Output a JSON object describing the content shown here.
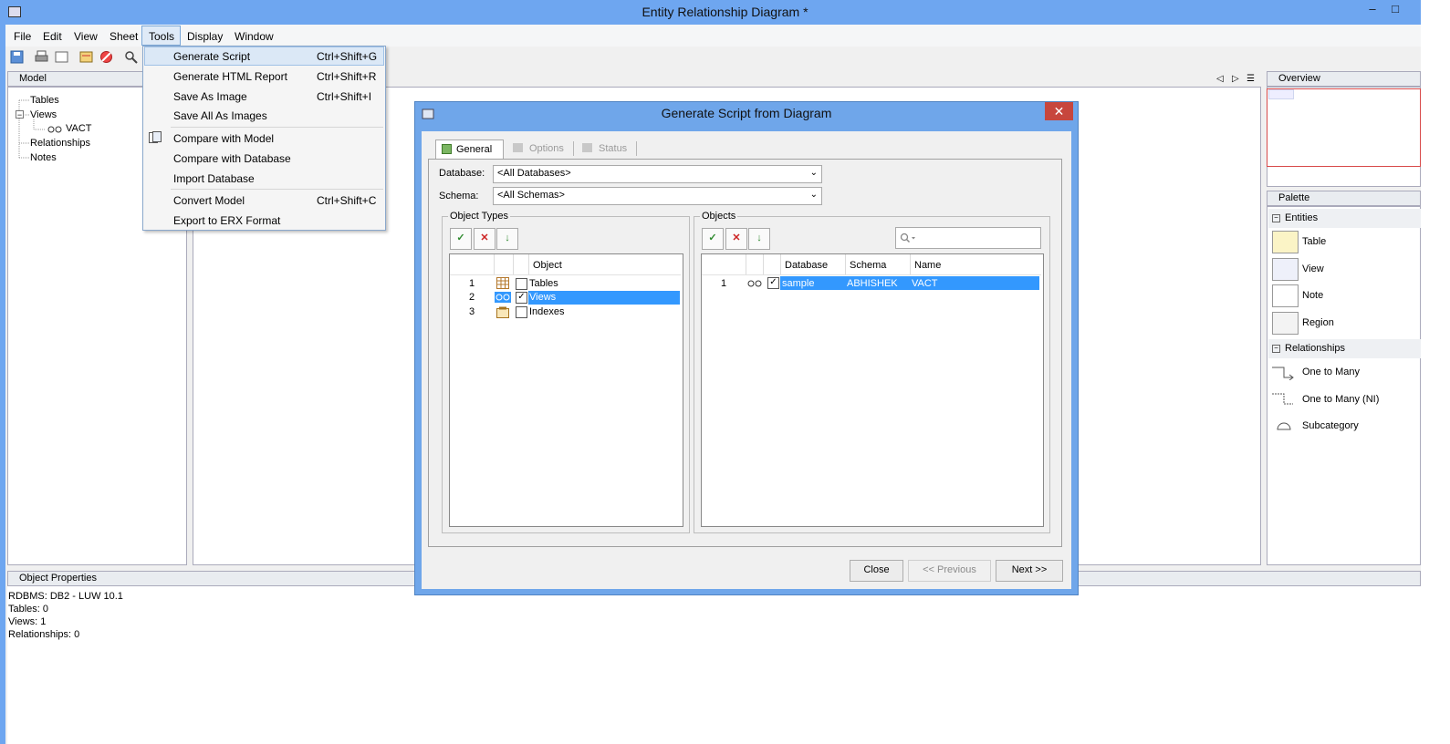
{
  "window": {
    "title": "Entity Relationship Diagram *",
    "minimize_glyph": "–",
    "maximize_glyph": "□"
  },
  "menubar": [
    "File",
    "Edit",
    "View",
    "Sheet",
    "Tools",
    "Display",
    "Window"
  ],
  "tools_menu": {
    "items": [
      {
        "label": "Generate Script",
        "shortcut": "Ctrl+Shift+G"
      },
      {
        "label": "Generate HTML Report",
        "shortcut": "Ctrl+Shift+R"
      },
      {
        "label": "Save As Image",
        "shortcut": "Ctrl+Shift+I"
      },
      {
        "label": "Save All As Images",
        "shortcut": ""
      },
      {
        "label": "Compare with Model",
        "shortcut": ""
      },
      {
        "label": "Compare with Database",
        "shortcut": ""
      },
      {
        "label": "Import Database",
        "shortcut": ""
      },
      {
        "label": "Convert Model",
        "shortcut": "Ctrl+Shift+C"
      },
      {
        "label": "Export to ERX Format",
        "shortcut": ""
      }
    ]
  },
  "model_panel": {
    "title": "Model",
    "tree": [
      "Tables",
      "Views",
      "VACT",
      "Relationships",
      "Notes"
    ],
    "expand_glyph": "−"
  },
  "overview": {
    "title": "Overview"
  },
  "palette": {
    "title": "Palette",
    "groups": [
      {
        "label": "Entities",
        "items": [
          "Table",
          "View",
          "Note",
          "Region"
        ]
      },
      {
        "label": "Relationships",
        "items": [
          "One to Many",
          "One to Many (NI)",
          "Subcategory"
        ]
      }
    ],
    "collapse_glyph": "−"
  },
  "object_properties": {
    "title": "Object Properties",
    "lines": [
      "RDBMS: DB2 - LUW 10.1",
      "Tables: 0",
      "Views: 1",
      "Relationships: 0"
    ]
  },
  "dialog": {
    "title": "Generate Script from Diagram",
    "close_glyph": "✕",
    "tabs": [
      "General",
      "Options",
      "Status"
    ],
    "database_label": "Database:",
    "database_value": "<All Databases>",
    "schema_label": "Schema:",
    "schema_value": "<All Schemas>",
    "object_types": {
      "title": "Object Types",
      "column": "Object",
      "rows": [
        {
          "num": "1",
          "name": "Tables",
          "checked": false
        },
        {
          "num": "2",
          "name": "Views",
          "checked": true
        },
        {
          "num": "3",
          "name": "Indexes",
          "checked": false
        }
      ]
    },
    "objects": {
      "title": "Objects",
      "columns": [
        "Database",
        "Schema",
        "Name"
      ],
      "rows": [
        {
          "num": "1",
          "database": "sample",
          "schema": "ABHISHEK",
          "name": "VACT",
          "checked": true
        }
      ]
    },
    "check_glyph": "✓",
    "buttons": {
      "close": "Close",
      "previous": "<< Previous",
      "next": "Next >>"
    }
  },
  "colors": {
    "titlebar": "#6ea6f0",
    "selection": "#3398fe",
    "dialog_close": "#c7463d"
  }
}
